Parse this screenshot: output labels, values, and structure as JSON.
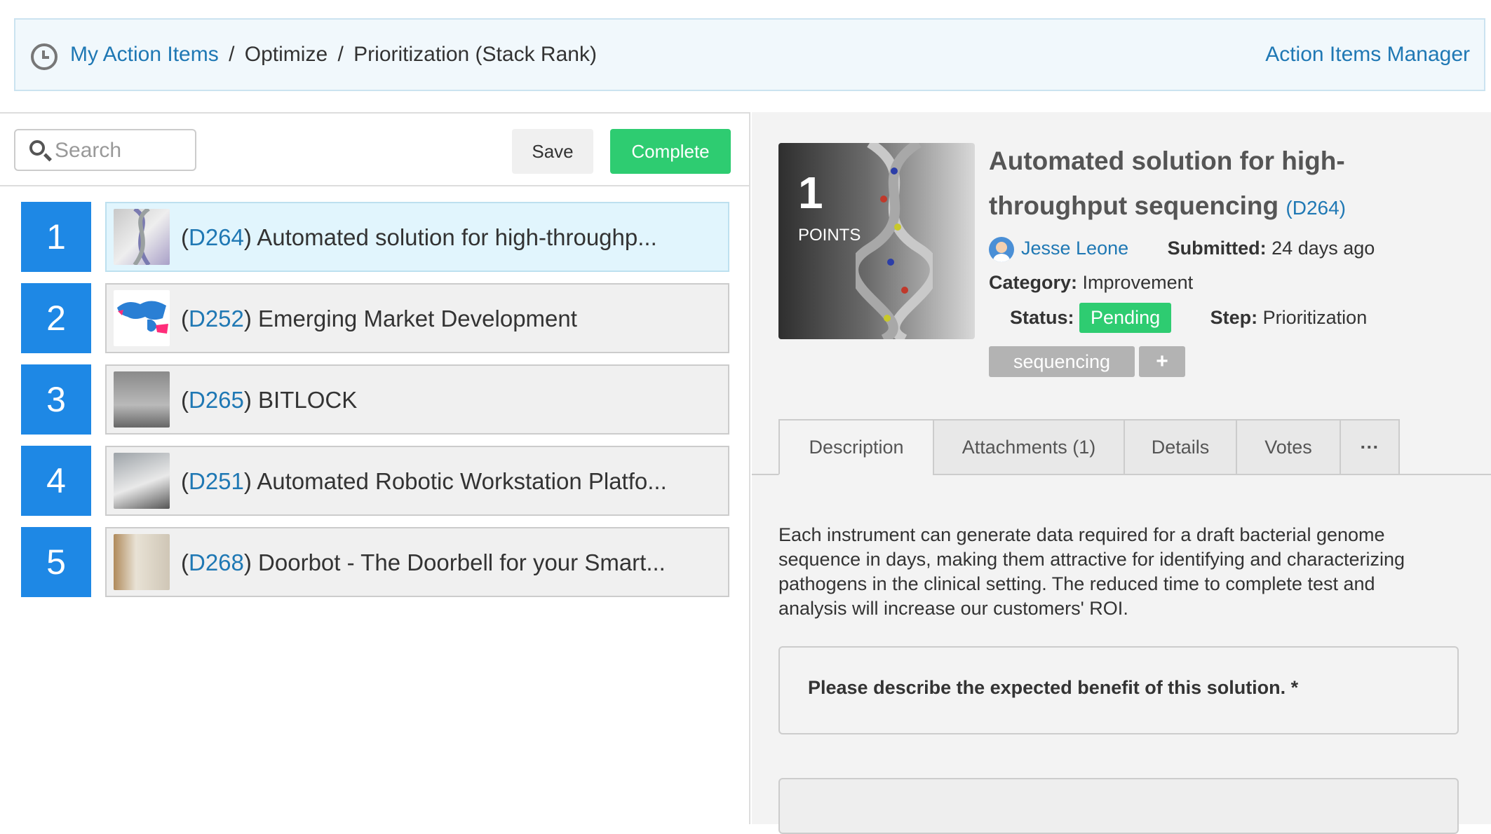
{
  "header": {
    "breadcrumb_root": "My Action Items",
    "breadcrumb_sep1": "/",
    "breadcrumb_mid": "Optimize",
    "breadcrumb_sep2": "/",
    "breadcrumb_current": "Prioritization (Stack Rank)",
    "manager_link": "Action Items Manager"
  },
  "toolbar": {
    "search_placeholder": "Search",
    "save_label": "Save",
    "complete_label": "Complete",
    "complete_color": "#2ecc71"
  },
  "rank_items": [
    {
      "rank": "1",
      "open": "(",
      "code": "D264",
      "title": ") Automated solution for high-throughp...",
      "thumb": "dna-thumbnail"
    },
    {
      "rank": "2",
      "open": "(",
      "code": "D252",
      "title": ") Emerging Market Development",
      "thumb": "world-map-thumbnail"
    },
    {
      "rank": "3",
      "open": "(",
      "code": "D265",
      "title": ") BITLOCK",
      "thumb": "street-bikes-thumbnail"
    },
    {
      "rank": "4",
      "open": "(",
      "code": "D251",
      "title": ") Automated Robotic Workstation Platfo...",
      "thumb": "lab-robot-thumbnail"
    },
    {
      "rank": "5",
      "open": "(",
      "code": "D268",
      "title": ") Doorbot - The Doorbell for your Smart...",
      "thumb": "doorbot-box-thumbnail"
    }
  ],
  "detail": {
    "points_value": "1",
    "points_label": "POINTS",
    "title": "Automated solution for high-throughput sequencing",
    "code_open": "(",
    "code": "D264",
    "code_close": ")",
    "user_name": "Jesse Leone",
    "submitted_label": "Submitted:",
    "submitted_value": "24 days ago",
    "category_label": "Category:",
    "category_value": "Improvement",
    "status_label": "Status:",
    "status_value": "Pending",
    "status_color": "#2ecc71",
    "step_label": "Step:",
    "step_value": "Prioritization",
    "tag": "sequencing",
    "tag_add": "+"
  },
  "tabs": [
    {
      "label": "Description",
      "active": true
    },
    {
      "label": "Attachments (1)"
    },
    {
      "label": "Details"
    },
    {
      "label": "Votes"
    },
    {
      "label": "···"
    }
  ],
  "description": "Each instrument can generate data required for a draft bacterial genome sequence in days, making them attractive for identifying and characterizing pathogens in the clinical setting.  The reduced time to complete test and analysis will increase our customers' ROI.",
  "question": "Please describe the expected benefit of this solution. *",
  "colors": {
    "accent_blue": "#1e88e5",
    "link_blue": "#1f78b4",
    "header_bg": "#f1f8fc"
  }
}
